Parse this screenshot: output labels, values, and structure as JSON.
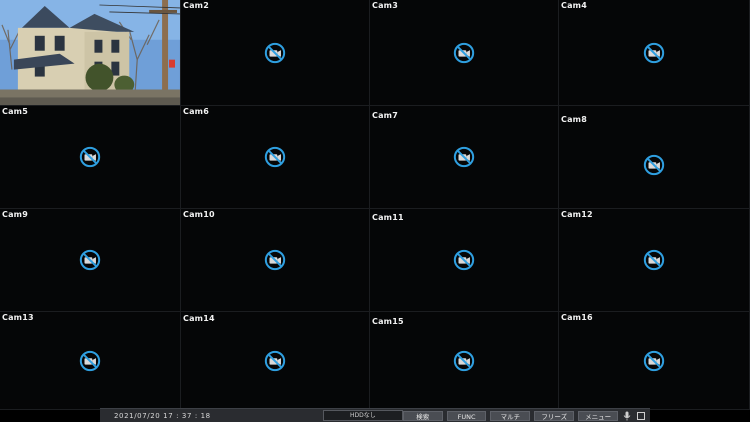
{
  "cameras": [
    {
      "label": "",
      "live": true
    },
    {
      "label": "Cam2"
    },
    {
      "label": "Cam3"
    },
    {
      "label": "Cam4"
    },
    {
      "label": "Cam5"
    },
    {
      "label": "Cam6"
    },
    {
      "label": "Cam7"
    },
    {
      "label": "Cam8"
    },
    {
      "label": "Cam9"
    },
    {
      "label": "Cam10"
    },
    {
      "label": "Cam11"
    },
    {
      "label": "Cam12"
    },
    {
      "label": "Cam13"
    },
    {
      "label": "Cam14"
    },
    {
      "label": "Cam15"
    },
    {
      "label": "Cam16"
    }
  ],
  "no_video_icon": "camera-off-icon",
  "colors": {
    "icon_blue": "#2f9fe0",
    "background": "#000000",
    "bar": "#2a2c30"
  },
  "statusbar": {
    "datetime": "2021/07/20  17 : 37 : 18",
    "hdd": "HDDなし",
    "buttons": {
      "search": "検索",
      "func": "FUNC",
      "multi": "マルチ",
      "freeze": "フリーズ",
      "menu": "メニュー"
    },
    "mic_icon": "microphone-icon",
    "record_icon": "square-icon"
  }
}
